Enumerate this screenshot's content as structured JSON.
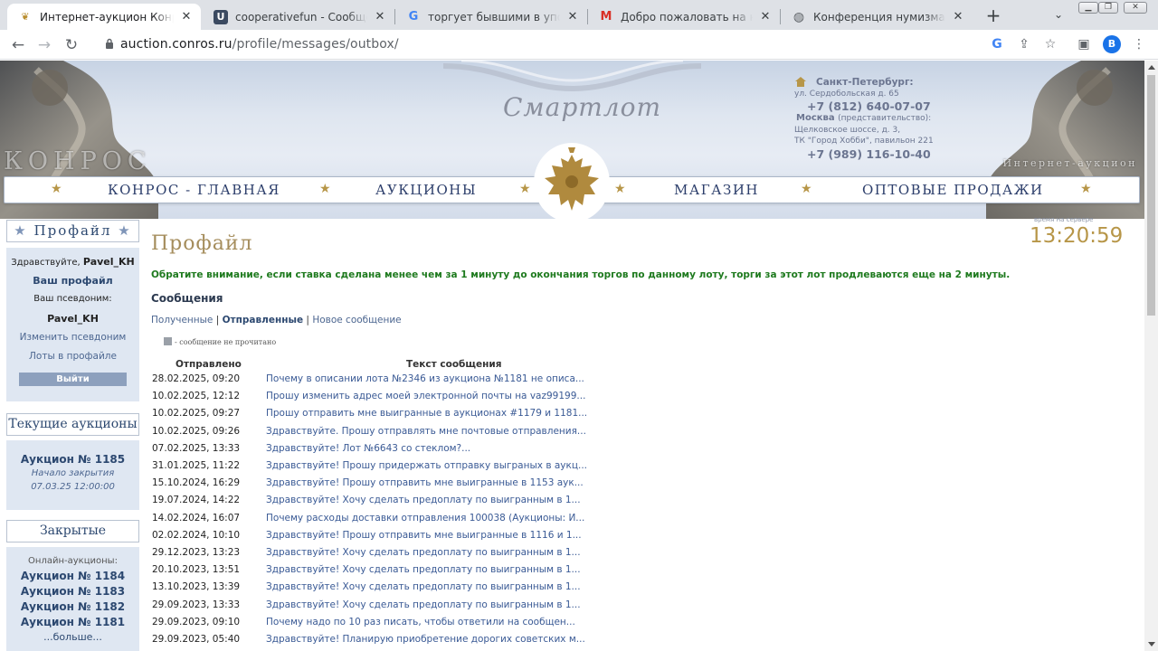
{
  "browser": {
    "tabs": [
      {
        "title": "Интернет-аукцион Конрос - г",
        "icon": "konros-favicon",
        "active": true
      },
      {
        "title": "cooperativefun - Сообщения",
        "icon": "u-favicon",
        "active": false
      },
      {
        "title": "торгует бывшими в употребл",
        "icon": "google-favicon",
        "active": false
      },
      {
        "title": "Добро пожаловать на конфер",
        "icon": "gmail-favicon",
        "active": false
      },
      {
        "title": "Конференция нумизматов - Н",
        "icon": "globe-favicon",
        "active": false
      }
    ],
    "url_host": "auction.conros.ru",
    "url_path": "/profile/messages/outbox/",
    "profile_letter": "B"
  },
  "header": {
    "brand_left": "КОНРОС",
    "brand_right": "Интернет-аукцион",
    "logo": "Смартлот",
    "contacts": {
      "spb_city": "Санкт-Петербург:",
      "spb_address": "ул. Сердобольская д. 65",
      "spb_phone": "+7 (812) 640-07-07",
      "msk_city": "Москва",
      "msk_note": "(представительство):",
      "msk_address1": "Щелковское шоссе, д. 3,",
      "msk_address2": "ТК \"Город Хобби\", павильон 221",
      "msk_phone": "+7 (989) 116-10-40"
    },
    "nav": [
      "КОНРОС - ГЛАВНАЯ",
      "АУКЦИОНЫ",
      "МАГАЗИН",
      "ОПТОВЫЕ ПРОДАЖИ"
    ]
  },
  "sidebar": {
    "profile_title": "Профайл",
    "greeting": "Здравствуйте,",
    "username": "Pavel_KH",
    "my_profile": "Ваш профайл",
    "alias_label": "Ваш псевдоним:",
    "alias": "Pavel_KH",
    "change_alias": "Изменить псевдоним",
    "lots_in_profile": "Лоты в профайле",
    "logout": "Выйти",
    "current_title": "Текущие аукционы",
    "current_auction": "Аукцион № 1185",
    "closing_label": "Начало закрытия",
    "closing_date": "07.03.25 12:00:00",
    "closed_title": "Закрытые аукционы",
    "online_label": "Онлайн-аукционы:",
    "closed_auctions": [
      "Аукцион № 1184",
      "Аукцион № 1183",
      "Аукцион № 1182",
      "Аукцион № 1181"
    ],
    "more": "...больше..."
  },
  "main": {
    "title": "Профайл",
    "server_time_label": "время на сервере",
    "server_time": "13:20:59",
    "notice": "Обратите внимание, если ставка сделана менее чем за 1 минуту до окончания торгов по данному лоту, торги за этот лот продлеваются еще на 2 минуты.",
    "messages_heading": "Сообщения",
    "tab_inbox": "Полученные",
    "tab_sent": "Отправленные",
    "tab_new": "Новое сообщение",
    "sep": "|",
    "legend": "- сообщение не прочитано",
    "col_sent": "Отправлено",
    "col_text": "Текст сообщения",
    "messages": [
      {
        "date": "28.02.2025, 09:20",
        "text": "Почему в описании лота №2346 из аукциона №1181 не описа..."
      },
      {
        "date": "10.02.2025, 12:12",
        "text": "Прошу изменить адрес моей электронной почты на vaz99199..."
      },
      {
        "date": "10.02.2025, 09:27",
        "text": "Прошу отправить мне выигранные в аукционах #1179 и 1181..."
      },
      {
        "date": "10.02.2025, 09:26",
        "text": "Здравствуйте. Прошу отправлять мне почтовые отправления..."
      },
      {
        "date": "07.02.2025, 13:33",
        "text": "Здравствуйте! Лот №6643 со стеклом?..."
      },
      {
        "date": "31.01.2025, 11:22",
        "text": "Здравствуйте! Прошу придержать отправку выграных в аукц..."
      },
      {
        "date": "15.10.2024, 16:29",
        "text": "Здравствуйте! Прошу отправить мне выигранные в 1153 аук..."
      },
      {
        "date": "19.07.2024, 14:22",
        "text": "Здравствуйте! Хочу сделать предоплату по выигранным в 1..."
      },
      {
        "date": "14.02.2024, 16:07",
        "text": "Почему расходы доставки отправления 100038 (Аукционы: И..."
      },
      {
        "date": "02.02.2024, 10:10",
        "text": "Здравствуйте! Прошу отправить мне выигранные в 1116 и 1..."
      },
      {
        "date": "29.12.2023, 13:23",
        "text": "Здравствуйте! Хочу сделать предоплату по выигранным в 1..."
      },
      {
        "date": "20.10.2023, 13:51",
        "text": "Здравствуйте! Хочу сделать предоплату по выигранным в 1..."
      },
      {
        "date": "13.10.2023, 13:39",
        "text": "Здравствуйте! Хочу сделать предоплату по выигранным в 1..."
      },
      {
        "date": "29.09.2023, 13:33",
        "text": "Здравствуйте! Хочу сделать предоплату по выигранным в 1..."
      },
      {
        "date": "29.09.2023, 09:10",
        "text": "Почему надо по 10 раз писать, чтобы ответили на сообщен..."
      },
      {
        "date": "29.09.2023, 05:40",
        "text": "Здравствуйте! Планирую приобретение дорогих советских м..."
      }
    ]
  }
}
